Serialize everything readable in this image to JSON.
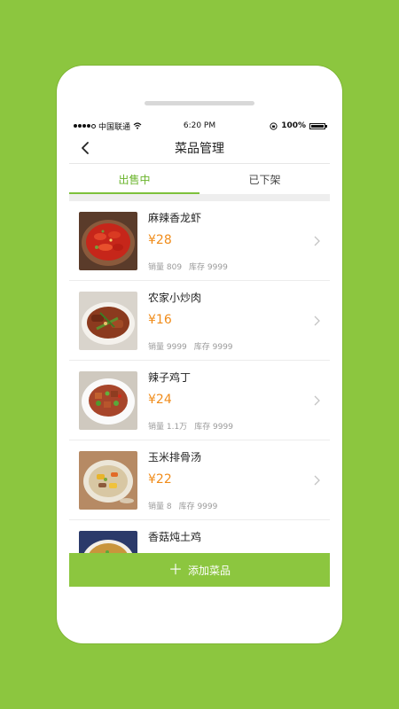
{
  "status_bar": {
    "carrier": "中国联通",
    "time": "6:20 PM",
    "battery": "100%",
    "battery_level": 1.0
  },
  "nav": {
    "title": "菜品管理"
  },
  "tabs": [
    {
      "label": "出售中",
      "active": true
    },
    {
      "label": "已下架",
      "active": false
    }
  ],
  "dishes": [
    {
      "name": "麻辣香龙虾",
      "price": "¥28",
      "sales": "销量 809",
      "stock": "库存 9999"
    },
    {
      "name": "农家小炒肉",
      "price": "¥16",
      "sales": "销量 9999",
      "stock": "库存 9999"
    },
    {
      "name": "辣子鸡丁",
      "price": "¥24",
      "sales": "销量 1.1万",
      "stock": "库存 9999"
    },
    {
      "name": "玉米排骨汤",
      "price": "¥22",
      "sales": "销量 8",
      "stock": "库存 9999"
    },
    {
      "name": "香菇炖土鸡",
      "price": "",
      "sales": "",
      "stock": ""
    }
  ],
  "add_button": {
    "label": "添加菜品"
  },
  "colors": {
    "background": "#8cc63f",
    "accent": "#7ec13b",
    "price": "#f08c1b"
  }
}
